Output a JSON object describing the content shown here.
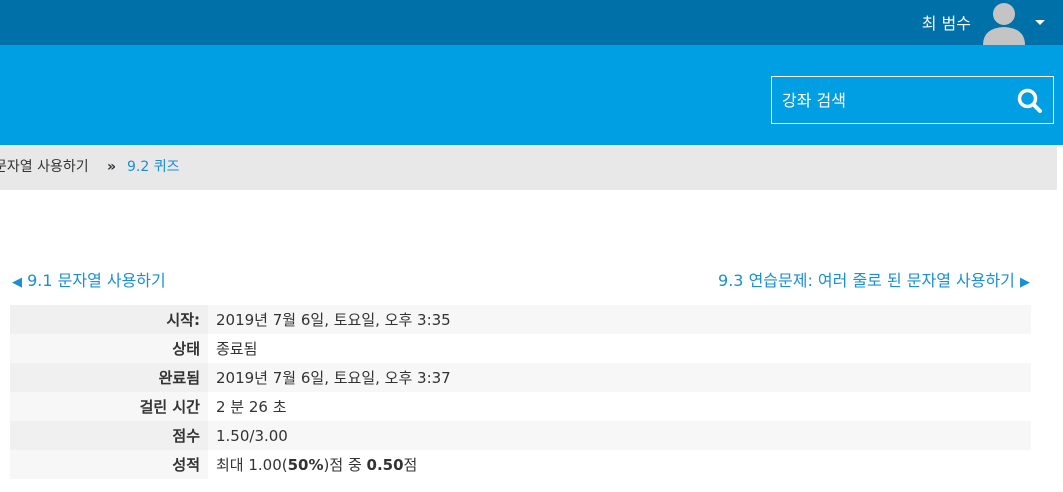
{
  "header": {
    "user_name": "최 범수",
    "avatar_icon": "user-avatar-icon",
    "menu_icon": "caret-down-icon"
  },
  "banner": {
    "search_placeholder": "강좌 검색",
    "search_icon": "search-icon"
  },
  "breadcrumb": {
    "prev": "문자열 사용하기",
    "separator": "»",
    "current": "9.2 퀴즈"
  },
  "nav": {
    "prev_label": "9.1 문자열 사용하기",
    "next_label": "9.3 연습문제: 여러 줄로 된 문자열 사용하기"
  },
  "summary": {
    "rows": [
      {
        "label": "시작:",
        "value": "2019년 7월 6일, 토요일, 오후 3:35"
      },
      {
        "label": "상태",
        "value": "종료됨"
      },
      {
        "label": "완료됨",
        "value": "2019년 7월 6일, 토요일, 오후 3:37"
      },
      {
        "label": "걸린 시간",
        "value": "2 분 26 초"
      },
      {
        "label": "점수",
        "value": "1.50/3.00"
      }
    ],
    "grade_label": "성적",
    "grade_prefix": "최대 1.00(",
    "grade_percent": "50%",
    "grade_middle": ")점 중 ",
    "grade_score": "0.50",
    "grade_suffix": "점"
  },
  "colors": {
    "topbar": "#0070a8",
    "banner": "#009fe3",
    "link": "#1a8fd4"
  }
}
